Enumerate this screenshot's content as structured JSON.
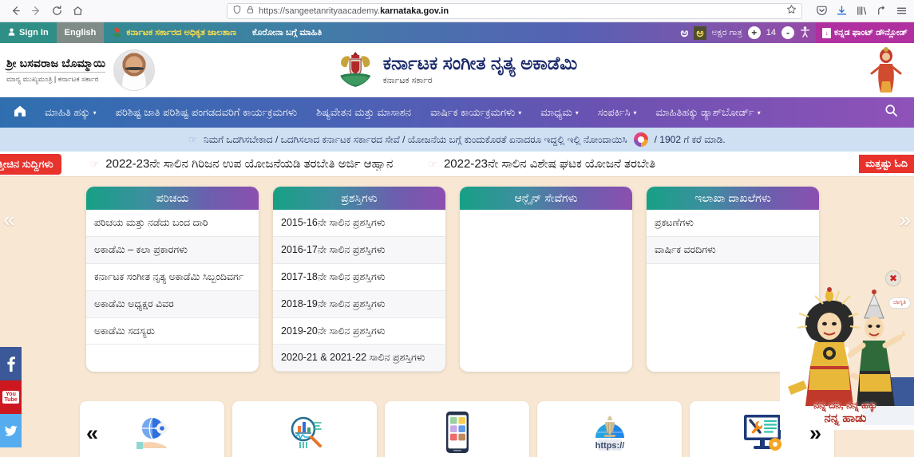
{
  "browser": {
    "url_prefix": "https://sangeetanrityaacademy.",
    "url_bold": "karnataka.gov.in",
    "back_icon": "back-arrow-icon",
    "forward_icon": "forward-arrow-icon",
    "reload_icon": "reload-icon",
    "home_icon": "home-icon",
    "shield_icon": "shield-icon",
    "lock_icon": "lock-icon",
    "bookmark_icon": "star-icon",
    "pocket_icon": "pocket-icon",
    "downloads_icon": "download-icon",
    "library_icon": "library-icon",
    "account_icon": "account-icon",
    "menu_icon": "hamburger-menu-icon"
  },
  "utility_bar": {
    "sign_in": "Sign In",
    "language": "English",
    "govt_portal": "ಕರ್ನಾಟಕ ಸರ್ಕಾರದ ಅಧಿಕೃತ ಜಾಲತಾಣ",
    "corona_info": "ಕೊರೋನಾ ಬಗ್ಗೆ ಮಾಹಿತಿ",
    "font_size_label": "ಅಕ್ಷರ ಗಾತ್ರ",
    "font_size_value": "14",
    "increase": "+",
    "decrease": "-",
    "accessibility_icon": "accessibility-icon",
    "font_download": "ಕನ್ನಡ ಫಾಂಟ್ ಡೌನ್ಲೋಡ್",
    "letter_big": "ಅ",
    "letter_small": "ಅ"
  },
  "header": {
    "cm_name": "ಶ್ರೀ ಬಸವರಾಜ ಬೊಮ್ಮಾಯಿ",
    "cm_role": "ಮಾನ್ಯ ಮುಖ್ಯಮಂತ್ರಿ | ಕರ್ನಾಟಕ ಸರ್ಕಾರ",
    "site_title": "ಕರ್ನಾಟಕ ಸಂಗೀತ ನೃತ್ಯ ಅಕಾಡೆಮಿ",
    "site_subtitle": "ಕರ್ನಾಟಕ ಸರ್ಕಾರ"
  },
  "nav": {
    "home_icon": "home-icon",
    "search_icon": "search-icon",
    "items": [
      {
        "label": "ಮಾಹಿತಿ ಹಕ್ಕು",
        "caret": "▾"
      },
      {
        "label": "ಪರಿಶಿಷ್ಟ ಜಾತಿ ಪರಿಶಿಷ್ಟ ಪಂಗಡದವರಿಗೆ ಕಾರ್ಯಕ್ರಮಗಳು",
        "caret": ""
      },
      {
        "label": "ಶಿಷ್ಯವೇತನ ಮತ್ತು ಮಾಸಾಶನ",
        "caret": ""
      },
      {
        "label": "ವಾರ್ಷಿಕ ಕಾರ್ಯಕ್ರಮಗಳು",
        "caret": "▾"
      },
      {
        "label": "ಮಾಧ್ಯಮ",
        "caret": "▾"
      },
      {
        "label": "ಸಂಪರ್ಕಿಸಿ",
        "caret": "▾"
      },
      {
        "label": "ಮಾಹಿತಿಹಕ್ಕು ಡ್ಯಾಶ್‌ಬೋರ್ಡ್",
        "caret": "▾"
      }
    ]
  },
  "notice": {
    "text": "ನಿಮಗೆ ಒದಗಿಸಬೇಕಾದ / ಒದಗಿಸಲಾದ ಕರ್ನಾಟಕ ಸರ್ಕಾರದ ಸೇವೆ / ಯೋಜನೆಯ ಬಗ್ಗೆ ಕುಂದುಕೊರತೆ ಏನಾದರೂ ಇದ್ದಲ್ಲಿ ಇಲ್ಲಿ ನೋಂದಾಯಿಸಿ",
    "suffix": "/ 1902 ಗೆ ಕರೆ ಮಾಡಿ."
  },
  "ticker": {
    "label": "ಇತ್ತೀಚಿನ ಸುದ್ದಿಗಳು",
    "items": [
      "2022-23ನೇ ಸಾಲಿನ ಗಿರಿಜನ ಉಪ ಯೋಜನೆಯಡಿ ತರಬೇತಿ ಅರ್ಜಿ ಆಹ್ವಾನ",
      "2022-23ನೇ ಸಾಲಿನ ವಿಶೇಷ ಘಟಕ ಯೋಜನೆ ತರಬೇತಿ"
    ],
    "read_more": "ಮತ್ತಷ್ಟು ಓದಿ"
  },
  "cards": [
    {
      "title": "ಪರಿಚಯ",
      "items": [
        "ಪರಿಚಯ ಮತ್ತು ನಡೆದು ಬಂದ ದಾರಿ",
        "ಅಕಾಡೆಮಿ – ಕಲಾ ಪ್ರಕಾರಗಳು",
        "ಕರ್ನಾಟಕ ಸಂಗೀತ ನೃತ್ಯ ಅಕಾಡೆಮಿ ಸಿಬ್ಬಂದಿವರ್ಗ",
        "ಅಕಾಡೆಮಿ ಅಧ್ಯಕ್ಷರ ವಿವರ",
        "ಅಕಾಡೆಮಿ ಸದಸ್ಯರು"
      ]
    },
    {
      "title": "ಪ್ರಶಸ್ತಿಗಳು",
      "items": [
        "2015-16ನೇ ಸಾಲಿನ ಪ್ರಶಸ್ತಿಗಳು",
        "2016-17ನೇ ಸಾಲಿನ ಪ್ರಶಸ್ತಿಗಳು",
        "2017-18ನೇ ಸಾಲಿನ ಪ್ರಶಸ್ತಿಗಳು",
        "2018-19ನೇ ಸಾಲಿನ ಪ್ರಶಸ್ತಿಗಳು",
        "2019-20ನೇ ಸಾಲಿನ ಪ್ರಶಸ್ತಿಗಳು",
        "2020-21 & 2021-22 ಸಾಲಿನ ಪ್ರಶಸ್ತಿಗಳು"
      ]
    },
    {
      "title": "ಆನ್ಲೈನ್ ಸೇವೆಗಳು",
      "items": []
    },
    {
      "title": "ಇಲಾಖಾ ದಾಖಲೆಗಳು",
      "items": [
        "ಪ್ರಕಟಣೆಗಳು",
        "ವಾರ್ಷಿಕ ವರದಿಗಳು"
      ]
    }
  ],
  "carousel": {
    "prev": "«",
    "next": "»"
  },
  "tiles": [
    {
      "icon": "globe-gear-service-icon"
    },
    {
      "icon": "magnifier-chart-icon"
    },
    {
      "icon": "mobile-apps-icon"
    },
    {
      "icon": "india-emblem-https-icon",
      "label": "https://"
    },
    {
      "icon": "monitor-tools-icon"
    }
  ],
  "social": [
    {
      "name": "facebook",
      "glyph": "f",
      "color": "#3b5998"
    },
    {
      "name": "youtube",
      "glyph": "You Tube",
      "color": "#cc181e"
    },
    {
      "name": "twitter",
      "glyph": "t",
      "color": "#55acee"
    }
  ],
  "promo": {
    "close": "✖",
    "bubble": "ಜಾಗೃತಿ",
    "caption_line1": "ನನ್ನ ದನಿ, ನನ್ನ ಹಕ್ಕು",
    "caption_line2": "ನನ್ನ ಹಾಡು"
  }
}
